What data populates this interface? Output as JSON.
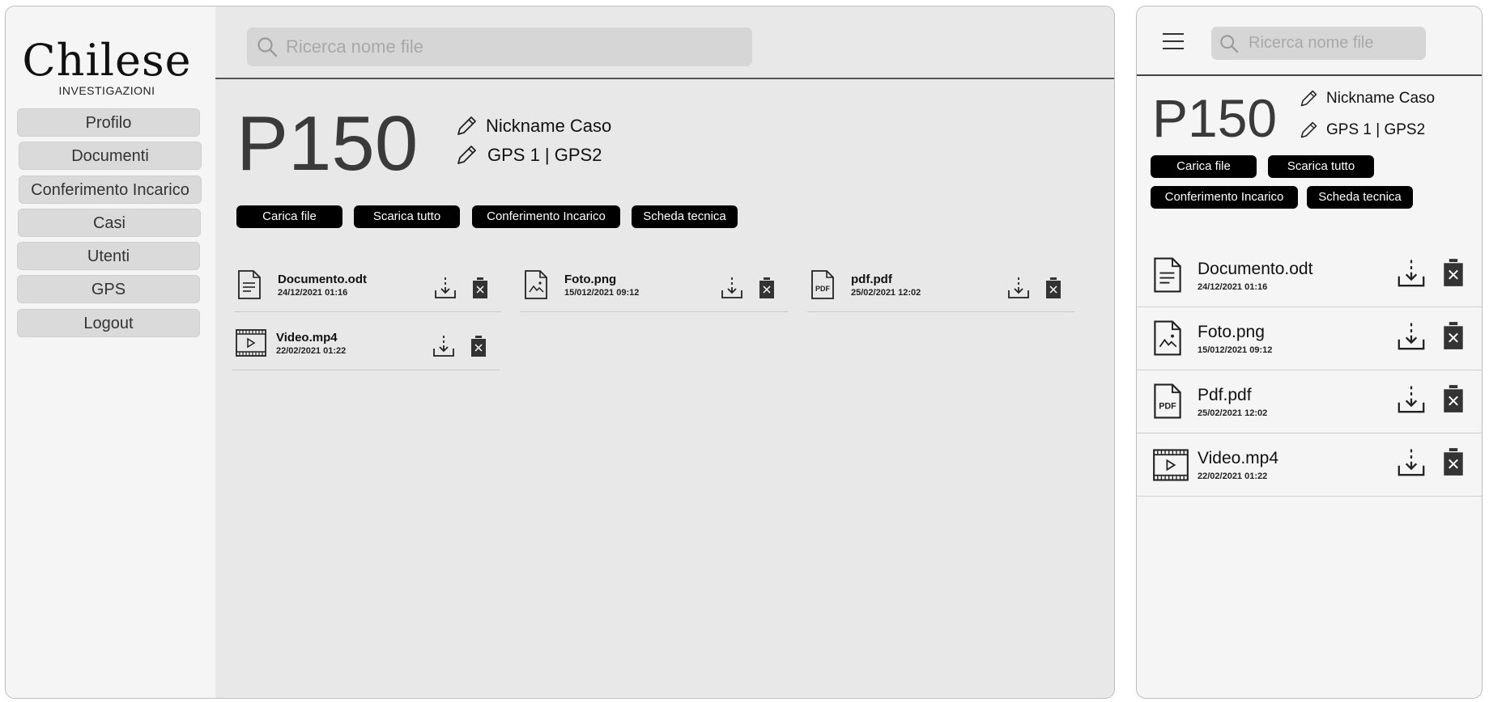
{
  "brand": {
    "name": "Chilese",
    "subtitle": "INVESTIGAZIONI"
  },
  "sidebar": {
    "items": [
      {
        "label": "Profilo"
      },
      {
        "label": "Documenti"
      },
      {
        "label": "Conferimento Incarico"
      },
      {
        "label": "Casi"
      },
      {
        "label": "Utenti"
      },
      {
        "label": "GPS"
      },
      {
        "label": "Logout"
      }
    ]
  },
  "search": {
    "placeholder": "Ricerca nome file"
  },
  "case": {
    "code": "P150",
    "nickname": "Nickname Caso",
    "gps": "GPS 1 | GPS2"
  },
  "actions": {
    "upload": "Carica file",
    "download_all": "Scarica tutto",
    "assignment": "Conferimento Incarico",
    "tech_sheet": "Scheda tecnica"
  },
  "files": [
    {
      "name": "Documento.odt",
      "date": "24/12/2021 01:16",
      "icon": "document-icon"
    },
    {
      "name": "Foto.png",
      "date": "15/012/2021 09:12",
      "icon": "image-file-icon"
    },
    {
      "name": "pdf.pdf",
      "date": "25/02/2021 12:02",
      "icon": "pdf-file-icon"
    },
    {
      "name": "Video.mp4",
      "date": "22/02/2021 01:22",
      "icon": "video-file-icon"
    }
  ],
  "mobile": {
    "files": [
      {
        "name": "Documento.odt",
        "date": "24/12/2021 01:16",
        "icon": "document-icon"
      },
      {
        "name": "Foto.png",
        "date": "15/012/2021 09:12",
        "icon": "image-file-icon"
      },
      {
        "name": "Pdf.pdf",
        "date": "25/02/2021 12:02",
        "icon": "pdf-file-icon"
      },
      {
        "name": "Video.mp4",
        "date": "22/02/2021 01:22",
        "icon": "video-file-icon"
      }
    ]
  }
}
